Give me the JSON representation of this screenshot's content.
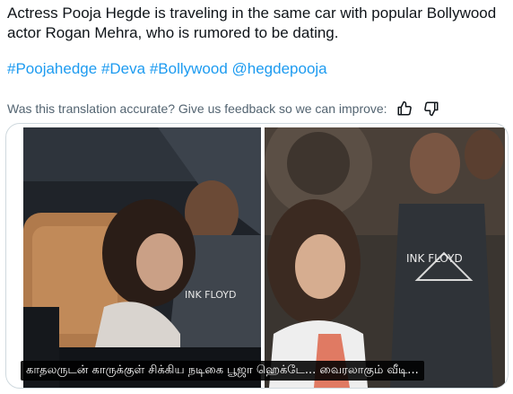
{
  "post": {
    "text": "Actress Pooja Hegde is traveling in the same car with popular Bollywood actor Rogan Mehra, who is rumored to be dating.",
    "hashtags": [
      "#Poojahedge",
      "#Deva",
      "#Bollywood",
      "@hegdepooja"
    ]
  },
  "feedback": {
    "prompt": "Was this translation accurate? Give us feedback so we can improve:",
    "like_icon": "thumbs-up-icon",
    "dislike_icon": "thumbs-down-icon"
  },
  "media": {
    "caption": "காதலருடன் காருக்குள் சிக்கிய நடிகை பூஜா ஹெக்டே... வைரலாகும் வீடி...",
    "shirt_text": "INK FLOYD"
  },
  "colors": {
    "link": "#1d9bf0",
    "muted": "#536471",
    "border": "#cfd9de",
    "text": "#0f1419"
  }
}
